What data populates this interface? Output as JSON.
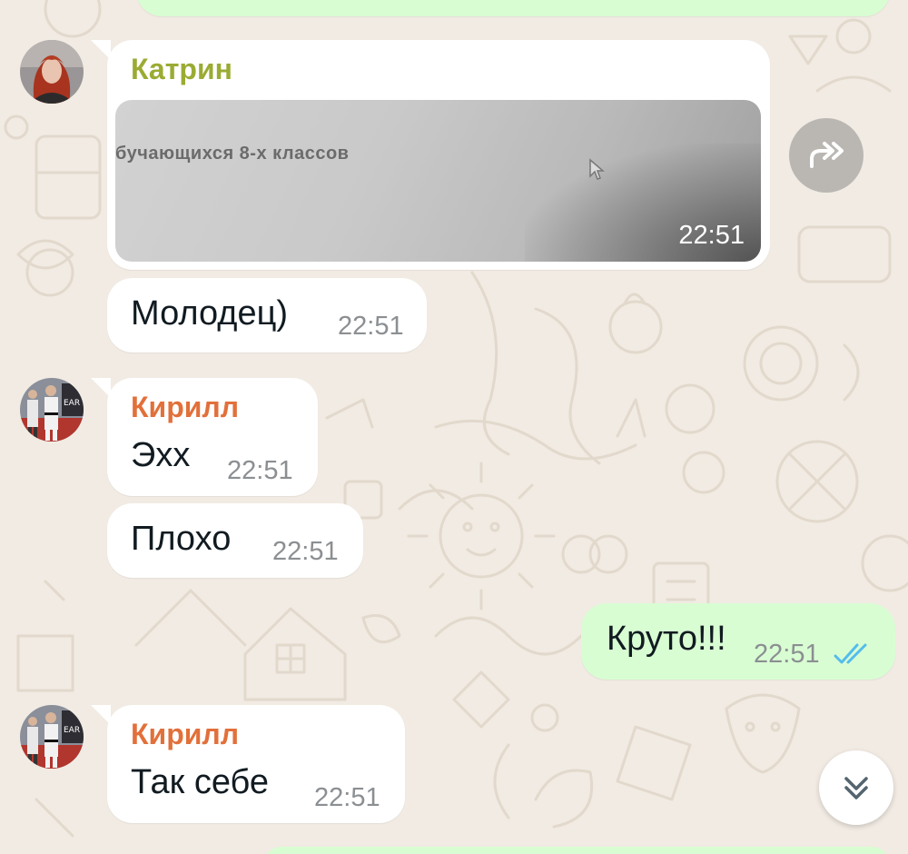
{
  "messages": [
    {
      "sender": "Катрин",
      "media_caption": "бучающихся 8-х классов",
      "time": "22:51"
    },
    {
      "text": "Молодец)",
      "time": "22:51"
    },
    {
      "sender": "Кирилл",
      "text": "Эхх",
      "time": "22:51"
    },
    {
      "text": "Плохо",
      "time": "22:51"
    },
    {
      "text": "Круто!!!",
      "time": "22:51",
      "status": "read"
    },
    {
      "sender": "Кирилл",
      "text": "Так себе",
      "time": "22:51"
    }
  ],
  "colors": {
    "background": "#f1ebe3",
    "incoming_bubble": "#ffffff",
    "outgoing_bubble": "#d9fdd3",
    "katrin_name": "#9bab33",
    "kirill_name": "#e2703a",
    "timestamp": "#8b8f92",
    "read_ticks": "#53bdeb"
  },
  "icons": {
    "forward": "forward-icon",
    "scroll_down": "double-chevron-down-icon",
    "read_status": "double-check-icon"
  }
}
